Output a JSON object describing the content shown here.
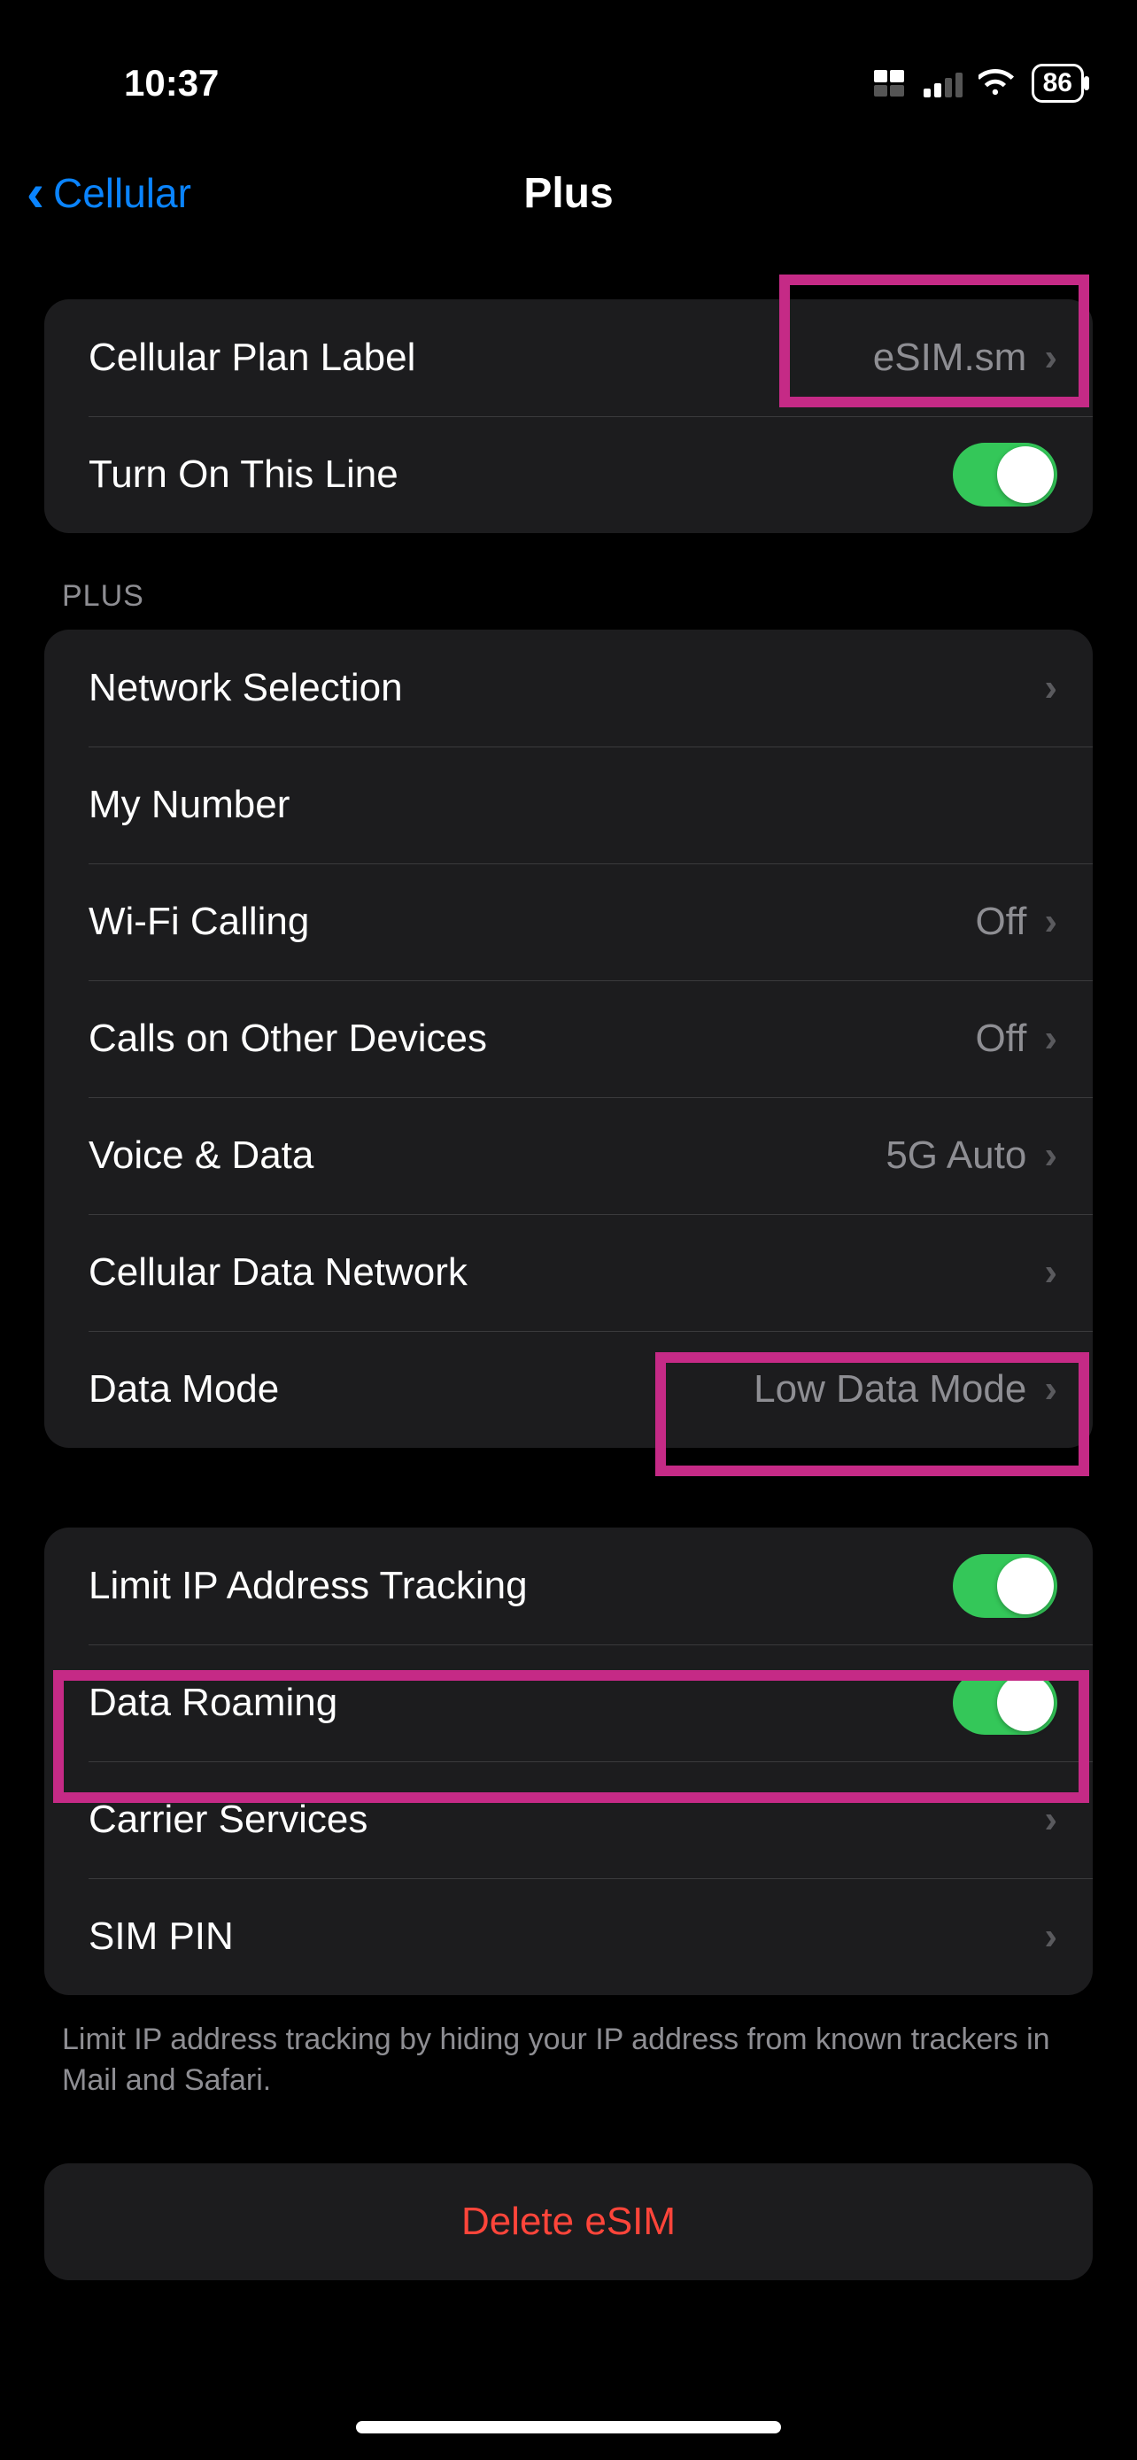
{
  "status": {
    "time": "10:37",
    "battery": "86"
  },
  "nav": {
    "back_label": "Cellular",
    "title": "Plus"
  },
  "group1": {
    "plan_label_title": "Cellular Plan Label",
    "plan_label_value": "eSIM.sm",
    "turn_on_title": "Turn On This Line"
  },
  "plus_header": "Plus",
  "group2": {
    "network_selection": "Network Selection",
    "my_number": "My Number",
    "wifi_calling": "Wi-Fi Calling",
    "wifi_calling_value": "Off",
    "calls_other": "Calls on Other Devices",
    "calls_other_value": "Off",
    "voice_data": "Voice & Data",
    "voice_data_value": "5G Auto",
    "cell_data_network": "Cellular Data Network",
    "data_mode": "Data Mode",
    "data_mode_value": "Low Data Mode"
  },
  "group3": {
    "limit_ip": "Limit IP Address Tracking",
    "data_roaming": "Data Roaming",
    "carrier_services": "Carrier Services",
    "sim_pin": "SIM PIN"
  },
  "footer": "Limit IP address tracking by hiding your IP address from known trackers in Mail and Safari.",
  "delete_label": "Delete eSIM"
}
